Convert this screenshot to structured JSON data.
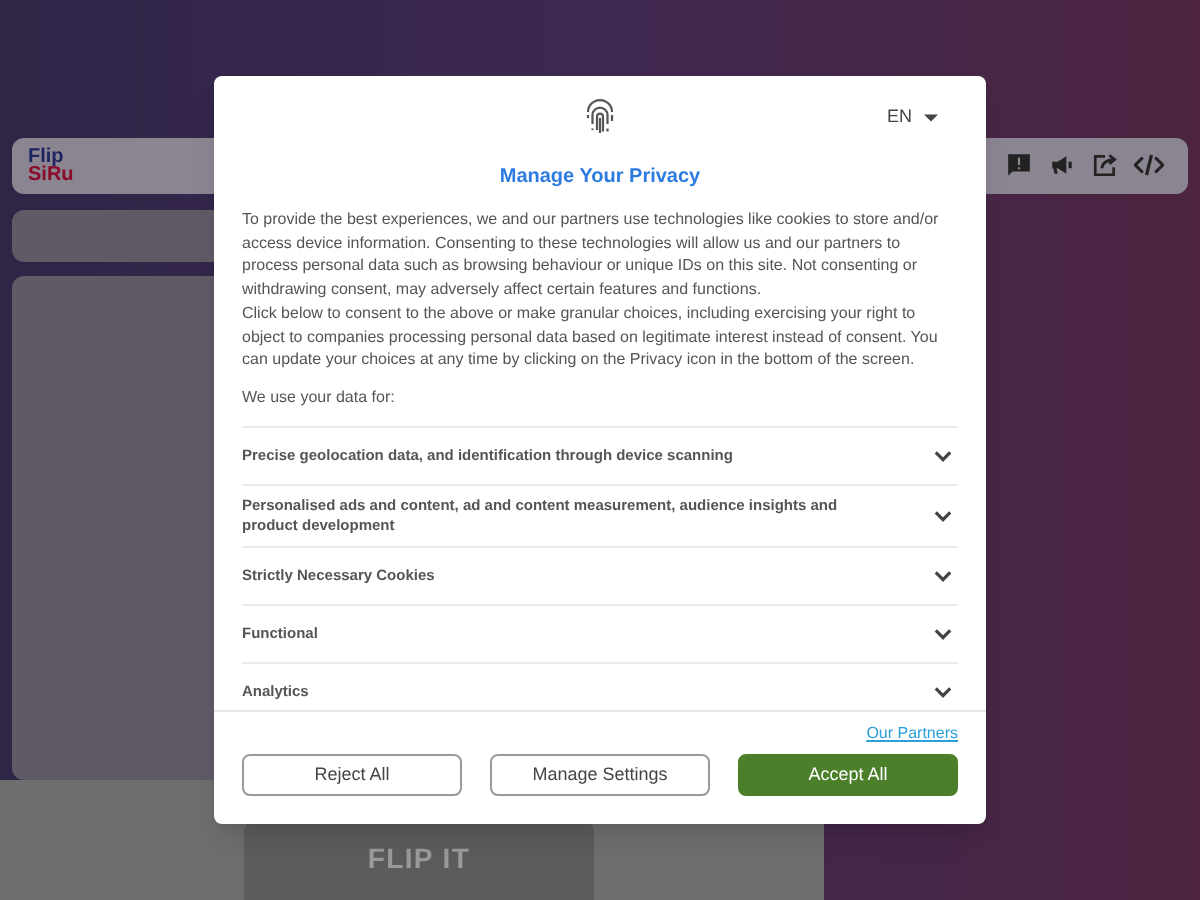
{
  "page": {
    "logo": [
      "Flip",
      "SiRu"
    ],
    "flip_button": "FLIP IT"
  },
  "dialog": {
    "language": "EN",
    "title": "Manage Your Privacy",
    "paragraphs": [
      "To provide the best experiences, we and our partners use technologies like cookies to store and/or access device information. Consenting to these technologies will allow us and our partners to process personal data such as browsing behaviour or unique IDs on this site. Not consenting or withdrawing consent, may adversely affect certain features and functions.",
      "Click below to consent to the above or make granular choices, including exercising your right to object to companies processing personal data based on legitimate interest instead of consent. You can update your choices at any time by clicking on the Privacy icon in the bottom of the screen.",
      "We use your data for:"
    ],
    "purposes": [
      {
        "label": "Precise geolocation data, and identification through device scanning",
        "expanded": false
      },
      {
        "label": "Personalised ads and content, ad and content measurement, audience insights and product development",
        "expanded": false
      },
      {
        "label": "Strictly Necessary Cookies",
        "expanded": false
      },
      {
        "label": "Functional",
        "expanded": false
      },
      {
        "label": "Analytics",
        "expanded": false
      }
    ],
    "partners_link": "Our Partners",
    "buttons": [
      {
        "label": "Reject All",
        "kind": "outline"
      },
      {
        "label": "Manage Settings",
        "kind": "outline"
      },
      {
        "label": "Accept All",
        "kind": "primary"
      }
    ]
  }
}
